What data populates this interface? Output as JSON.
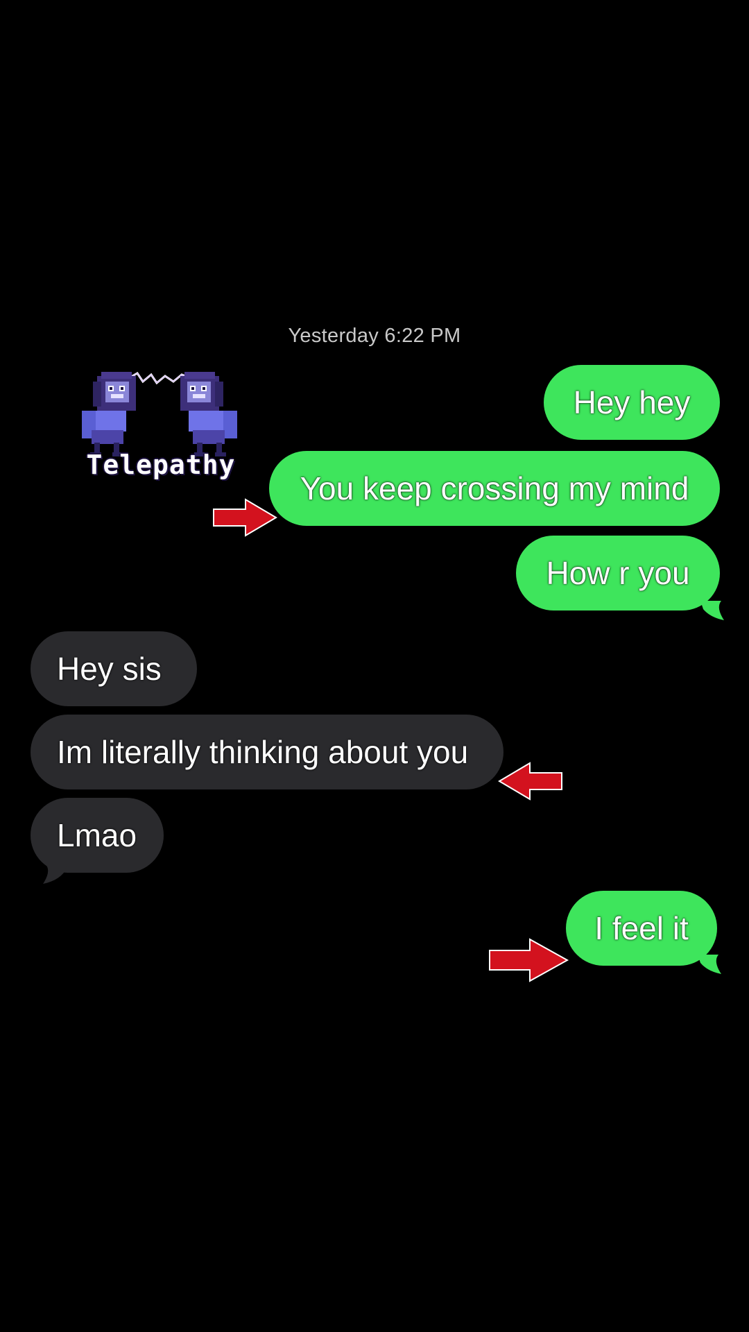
{
  "conversation": {
    "timestamp": "Yesterday 6:22 PM",
    "sticker": {
      "label": "Telepathy",
      "icon": "telepathy-sticker-icon"
    },
    "messages": [
      {
        "direction": "sent",
        "text": "Hey hey"
      },
      {
        "direction": "sent",
        "text": "You keep crossing my mind"
      },
      {
        "direction": "sent",
        "text": "How r you"
      },
      {
        "direction": "received",
        "text": "Hey sis"
      },
      {
        "direction": "received",
        "text": "Im literally thinking about you"
      },
      {
        "direction": "received",
        "text": "Lmao"
      },
      {
        "direction": "sent",
        "text": "I feel it"
      }
    ]
  },
  "colors": {
    "background": "#000000",
    "sent_bubble": "#3ee55c",
    "received_bubble": "#2a2a2d",
    "arrow_annotation": "#d3121e",
    "timestamp_text": "#c9c9c9"
  },
  "annotations": {
    "arrow_icon": "red-arrow-icon"
  }
}
